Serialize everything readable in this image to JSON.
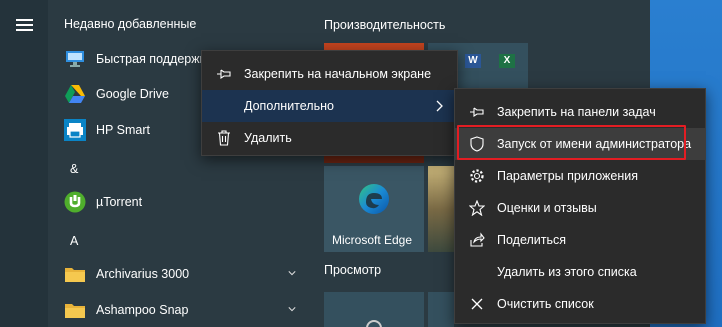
{
  "start_menu": {
    "recent_header": "Недавно добавленные",
    "productivity_header": "Производительность",
    "browse_header": "Просмотр",
    "apps": [
      {
        "label": "Быстрая поддержка",
        "icon": "quick-assist-icon"
      },
      {
        "label": "Google Drive",
        "icon": "google-drive-icon"
      },
      {
        "label": "HP Smart",
        "icon": "hp-smart-icon"
      },
      {
        "label": "µTorrent",
        "icon": "utorrent-icon"
      },
      {
        "label": "Archivarius 3000",
        "icon": "folder-icon"
      },
      {
        "label": "Ashampoo Snap",
        "icon": "folder-icon"
      }
    ],
    "letters": [
      "&",
      "A"
    ],
    "tiles": {
      "edge_label": "Microsoft Edge",
      "word_glyph": "W",
      "excel_glyph": "X"
    }
  },
  "context_menu": {
    "items": [
      {
        "label": "Закрепить на начальном экране",
        "icon": "pin-icon"
      },
      {
        "label": "Дополнительно",
        "icon": "chevron-right-icon"
      },
      {
        "label": "Удалить",
        "icon": "trash-icon"
      }
    ]
  },
  "submenu": {
    "items": [
      {
        "label": "Закрепить на панели задач",
        "icon": "pin-icon"
      },
      {
        "label": "Запуск от имени администратора",
        "icon": "shield-icon"
      },
      {
        "label": "Параметры приложения",
        "icon": "gear-icon"
      },
      {
        "label": "Оценки и отзывы",
        "icon": "star-icon"
      },
      {
        "label": "Поделиться",
        "icon": "share-icon"
      },
      {
        "label": "Удалить из этого списка",
        "icon": ""
      },
      {
        "label": "Очистить список",
        "icon": "close-icon"
      }
    ]
  },
  "colors": {
    "highlight": "#e31d23",
    "menu_bg": "#2b2b2b",
    "panel_bg": "#2b3a42",
    "desktop_blue": "#1f6fc2"
  }
}
